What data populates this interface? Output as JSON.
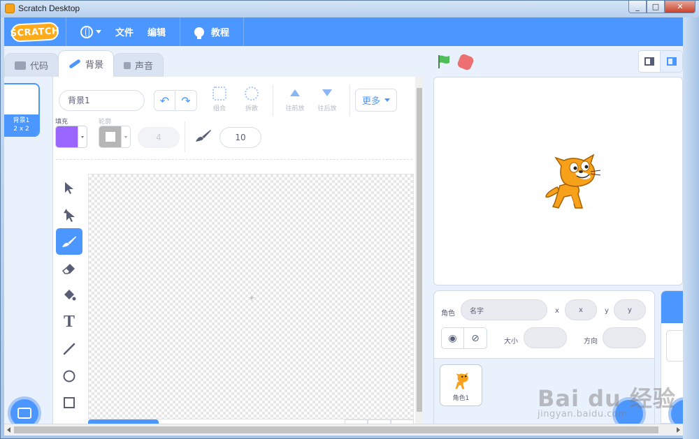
{
  "window": {
    "title": "Scratch Desktop",
    "min": "_",
    "max": "□",
    "close": "✕"
  },
  "menubar": {
    "logo": "SCRATCH",
    "file": "文件",
    "edit": "编辑",
    "tutorials": "教程"
  },
  "tabs": [
    {
      "label": "代码",
      "icon": "code-icon"
    },
    {
      "label": "背景",
      "icon": "brush-icon",
      "active": true
    },
    {
      "label": "声音",
      "icon": "sound-icon"
    }
  ],
  "backdrop_list": [
    {
      "name": "背景1",
      "size": "2 x 2",
      "selected": true
    }
  ],
  "paint_editor": {
    "costume_name": "背景1",
    "group_label": "组合",
    "ungroup_label": "拆散",
    "forward_label": "往前放",
    "backward_label": "往后放",
    "more_label": "更多",
    "fill_label": "填充",
    "outline_label": "轮廓",
    "fill_color": "#9966ff",
    "outline_color": "#9e9e9e",
    "outline_width": "4",
    "brush_size": "10",
    "tools": [
      "select-tool",
      "reshape-tool",
      "brush-tool",
      "eraser-tool",
      "fill-tool",
      "text-tool",
      "line-tool",
      "circle-tool",
      "rectangle-tool"
    ],
    "active_tool": "brush-tool",
    "crosshair": "✦"
  },
  "sprite_info": {
    "sprite_label": "角色",
    "name_placeholder": "名字",
    "x_label": "x",
    "x_placeholder": "x",
    "y_label": "y",
    "y_placeholder": "y",
    "size_label": "大小",
    "direction_label": "方向"
  },
  "sprites": [
    {
      "name": "角色1"
    }
  ],
  "colors": {
    "accent": "#4c97ff",
    "menubar": "#4c97ff",
    "flag": "#4cbf56",
    "stop": "#ec5959"
  },
  "watermark": {
    "big": "Bai du 经验",
    "small": "jingyan.baidu.com"
  }
}
